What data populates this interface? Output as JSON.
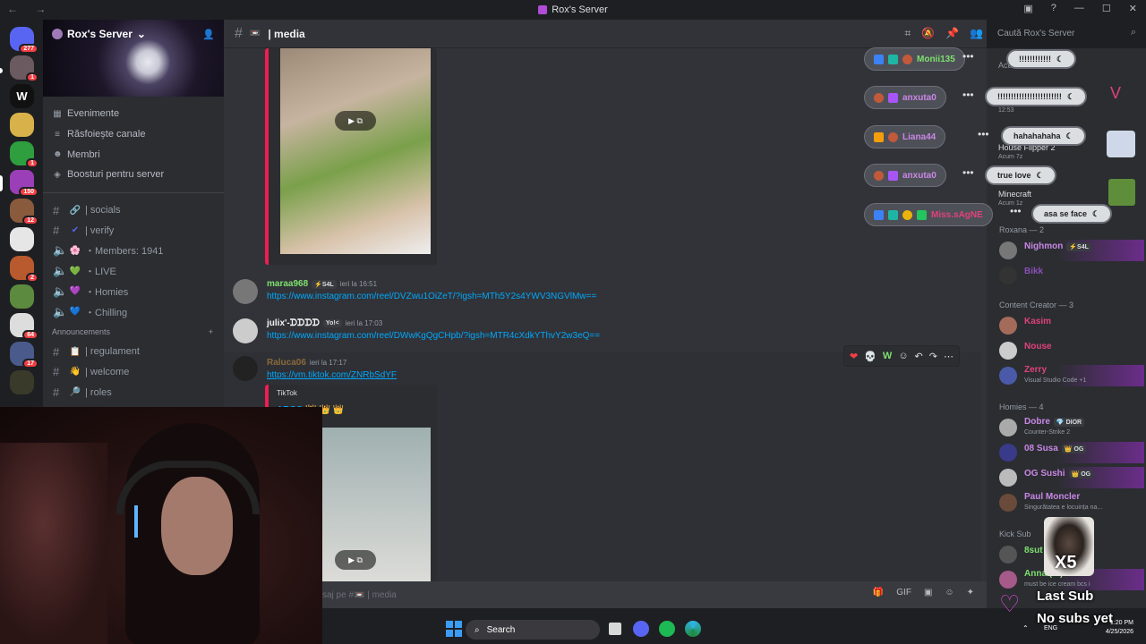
{
  "window": {
    "title": "Rox's Server"
  },
  "servers": [
    {
      "badge": "277"
    },
    {
      "badge": "1"
    },
    {
      "badge": ""
    },
    {
      "badge": ""
    },
    {
      "badge": "1"
    },
    {
      "badge": "150"
    },
    {
      "badge": "12"
    },
    {
      "badge": ""
    },
    {
      "badge": "2"
    },
    {
      "badge": ""
    },
    {
      "badge": "64"
    },
    {
      "badge": "17"
    },
    {
      "badge": ""
    }
  ],
  "sidebar": {
    "server_name": "Rox's Server",
    "menu": [
      {
        "label": "Evenimente",
        "icon": "calendar-icon"
      },
      {
        "label": "Răsfoiește canale",
        "icon": "browse-icon"
      },
      {
        "label": "Membri",
        "icon": "members-icon"
      },
      {
        "label": "Boosturi pentru server",
        "icon": "boost-icon"
      }
    ],
    "channels": [
      {
        "name": "| socials",
        "emoji": "🔗",
        "type": "text"
      },
      {
        "name": "| verify",
        "emoji": "✔",
        "type": "text"
      },
      {
        "name": "・Members: 1941",
        "emoji": "🌸",
        "type": "voice"
      },
      {
        "name": "・LIVE",
        "emoji": "💚",
        "type": "voice"
      },
      {
        "name": "・Homies",
        "emoji": "💜",
        "type": "voice"
      },
      {
        "name": "・Chilling",
        "emoji": "💙",
        "type": "voice"
      }
    ],
    "category": "Announcements",
    "announce_channels": [
      {
        "name": "| regulament",
        "emoji": "📋"
      },
      {
        "name": "| welcome",
        "emoji": "👋"
      },
      {
        "name": "| roles",
        "emoji": "🔎"
      }
    ]
  },
  "header": {
    "channel": "| media",
    "search_placeholder": "Caută Rox's Server"
  },
  "messages": [
    {
      "user": "maraa968",
      "tag": "⚡S4L",
      "time": "ieri la 16:51",
      "link": "https://www.instagram.com/reel/DVZwu1OiZeT/?igsh=MTh5Y2s4YWV3NGVlMw=="
    },
    {
      "user": "julix'-ᗪᗪᗪᗪ",
      "tag": "Yo!<",
      "time": "ieri la 17:03",
      "link": "https://www.instagram.com/reel/DWwKgQgCHpb/?igsh=MTR4cXdkYThvY2w3eQ=="
    },
    {
      "user": "Raluca06",
      "tag": "",
      "time": "ieri la 17:17",
      "link": "https://vm.tiktok.com/ZNRbSdYF"
    }
  ],
  "embed": {
    "provider": "TikTok",
    "author": "ARCO 👑 👑 👑"
  },
  "composer": {
    "placeholder": "saj pe #📼 | media"
  },
  "voice_users": [
    {
      "name": "Monii135",
      "color": "#7ee06e"
    },
    {
      "name": "anxuta0",
      "color": "#c987e6"
    },
    {
      "name": "Liana44",
      "color": "#c987e6"
    },
    {
      "name": "anxuta0",
      "color": "#c987e6"
    },
    {
      "name": "Miss.sAgNE",
      "color": "#e0427a"
    }
  ],
  "bubbles": [
    "!!!!!!!!!!!!",
    "!!!!!!!!!!!!!!!!!!!!!!!!",
    "hahahahaha",
    "true love",
    "asa se face"
  ],
  "activity": {
    "label": "Activitate — 14",
    "items": [
      {
        "title": "House Flipper 2",
        "sub": "Acum 7z"
      },
      {
        "title": "Minecraft",
        "sub": "Acum 1z"
      }
    ],
    "time": "12:53"
  },
  "member_groups": [
    {
      "label": "Roxana — 2",
      "members": [
        {
          "name": "Nighmon",
          "tag": "⚡S4L",
          "status": "",
          "color": "#c987e6"
        },
        {
          "name": "Bikk",
          "tag": "",
          "status": "",
          "color": "#8a4fb8"
        }
      ]
    },
    {
      "label": "Content Creator — 3",
      "members": [
        {
          "name": "Kasim",
          "tag": "",
          "status": "",
          "color": "#e0427a"
        },
        {
          "name": "Nouse",
          "tag": "",
          "status": "",
          "color": "#e0427a"
        },
        {
          "name": "Zerry",
          "tag": "",
          "status": "Visual Studio Code +1",
          "color": "#e0427a"
        }
      ]
    },
    {
      "label": "Homies — 4",
      "members": [
        {
          "name": "Dobre",
          "tag": "💎 DIOR",
          "status": "Counter-Strike 2",
          "color": "#c987e6"
        },
        {
          "name": "08 Susa",
          "tag": "👑 OG",
          "status": "",
          "color": "#c987e6"
        },
        {
          "name": "OG Sushi",
          "tag": "👑 OG",
          "status": "",
          "color": "#c987e6"
        },
        {
          "name": "Paul Moncler",
          "tag": "",
          "status": "Singurătatea e locuința na...",
          "color": "#c987e6"
        }
      ]
    },
    {
      "label": "Kick Sub",
      "members": [
        {
          "name": "8sut",
          "tag": "",
          "status": "",
          "color": "#7ee06e"
        },
        {
          "name": "Anna.(m)",
          "tag": "",
          "status": "must be ice cream bcs i",
          "color": "#7ee06e"
        }
      ]
    }
  ],
  "overlay": {
    "multiplier": "X5",
    "last_sub": "Last Sub",
    "no_subs": "No subs yet"
  },
  "taskbar": {
    "search": "Search",
    "lang": "ENG",
    "time": "1:20 PM",
    "date": "4/25/2026"
  }
}
